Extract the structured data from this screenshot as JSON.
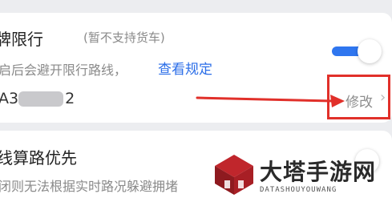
{
  "restriction": {
    "title": "牌限行",
    "note": "(暂不支持货车)",
    "description": "启后会避开限行路线，",
    "link": "查看规定",
    "enabled": true
  },
  "plate": {
    "visible_prefix": "A3",
    "visible_suffix": "2"
  },
  "modify": {
    "label": "修改",
    "chevron": "›"
  },
  "route_option": {
    "title": "线算路优先",
    "description": "闭则无法根据实时路况躲避拥堵"
  },
  "watermark": {
    "title": "大塔手游网",
    "subtitle": "DATASHOUYOUWANG"
  },
  "colors": {
    "accent": "#2f76ef",
    "highlight_box": "#e1302a",
    "logo": "#c0262c"
  }
}
